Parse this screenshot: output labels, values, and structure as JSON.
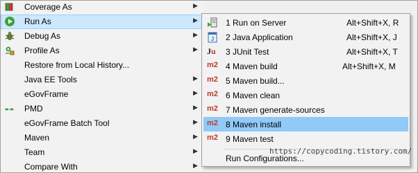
{
  "main_menu": {
    "items": [
      {
        "label": "Coverage As",
        "has_submenu": true,
        "icon": "coverage-icon"
      },
      {
        "label": "Run As",
        "has_submenu": true,
        "icon": "run-icon",
        "highlighted": true
      },
      {
        "label": "Debug As",
        "has_submenu": true,
        "icon": "debug-icon"
      },
      {
        "label": "Profile As",
        "has_submenu": true,
        "icon": "profile-icon"
      },
      {
        "label": "Restore from Local History...",
        "has_submenu": false,
        "icon": ""
      },
      {
        "label": "Java EE Tools",
        "has_submenu": true,
        "icon": ""
      },
      {
        "label": "eGovFrame",
        "has_submenu": true,
        "icon": ""
      },
      {
        "label": "PMD",
        "has_submenu": true,
        "icon": "pmd-icon"
      },
      {
        "label": "eGovFrame Batch Tool",
        "has_submenu": true,
        "icon": ""
      },
      {
        "label": "Maven",
        "has_submenu": true,
        "icon": ""
      },
      {
        "label": "Team",
        "has_submenu": true,
        "icon": ""
      },
      {
        "label": "Compare With",
        "has_submenu": true,
        "icon": ""
      }
    ]
  },
  "sub_menu": {
    "items": [
      {
        "label": "1 Run on Server",
        "accel": "Alt+Shift+X, R",
        "icon": "server-icon"
      },
      {
        "label": "2 Java Application",
        "accel": "Alt+Shift+X, J",
        "icon": "java-app-icon"
      },
      {
        "label": "3 JUnit Test",
        "accel": "Alt+Shift+X, T",
        "icon": "junit-icon"
      },
      {
        "label": "4 Maven build",
        "accel": "Alt+Shift+X, M",
        "icon": "m2-icon"
      },
      {
        "label": "5 Maven build...",
        "accel": "",
        "icon": "m2-icon"
      },
      {
        "label": "6 Maven clean",
        "accel": "",
        "icon": "m2-icon"
      },
      {
        "label": "7 Maven generate-sources",
        "accel": "",
        "icon": "m2-icon"
      },
      {
        "label": "8 Maven install",
        "accel": "",
        "icon": "m2-icon",
        "highlighted": true
      },
      {
        "label": "9 Maven test",
        "accel": "",
        "icon": "m2-icon"
      }
    ],
    "footer_item": "Run Configurations...",
    "m2_text": "m2",
    "ju_text": "Ju"
  },
  "watermark": "https://copycoding.tistory.com/",
  "colors": {
    "highlight_main": "#cce8ff",
    "highlight_sub": "#91c9f7",
    "m2_red": "#c0392b"
  }
}
